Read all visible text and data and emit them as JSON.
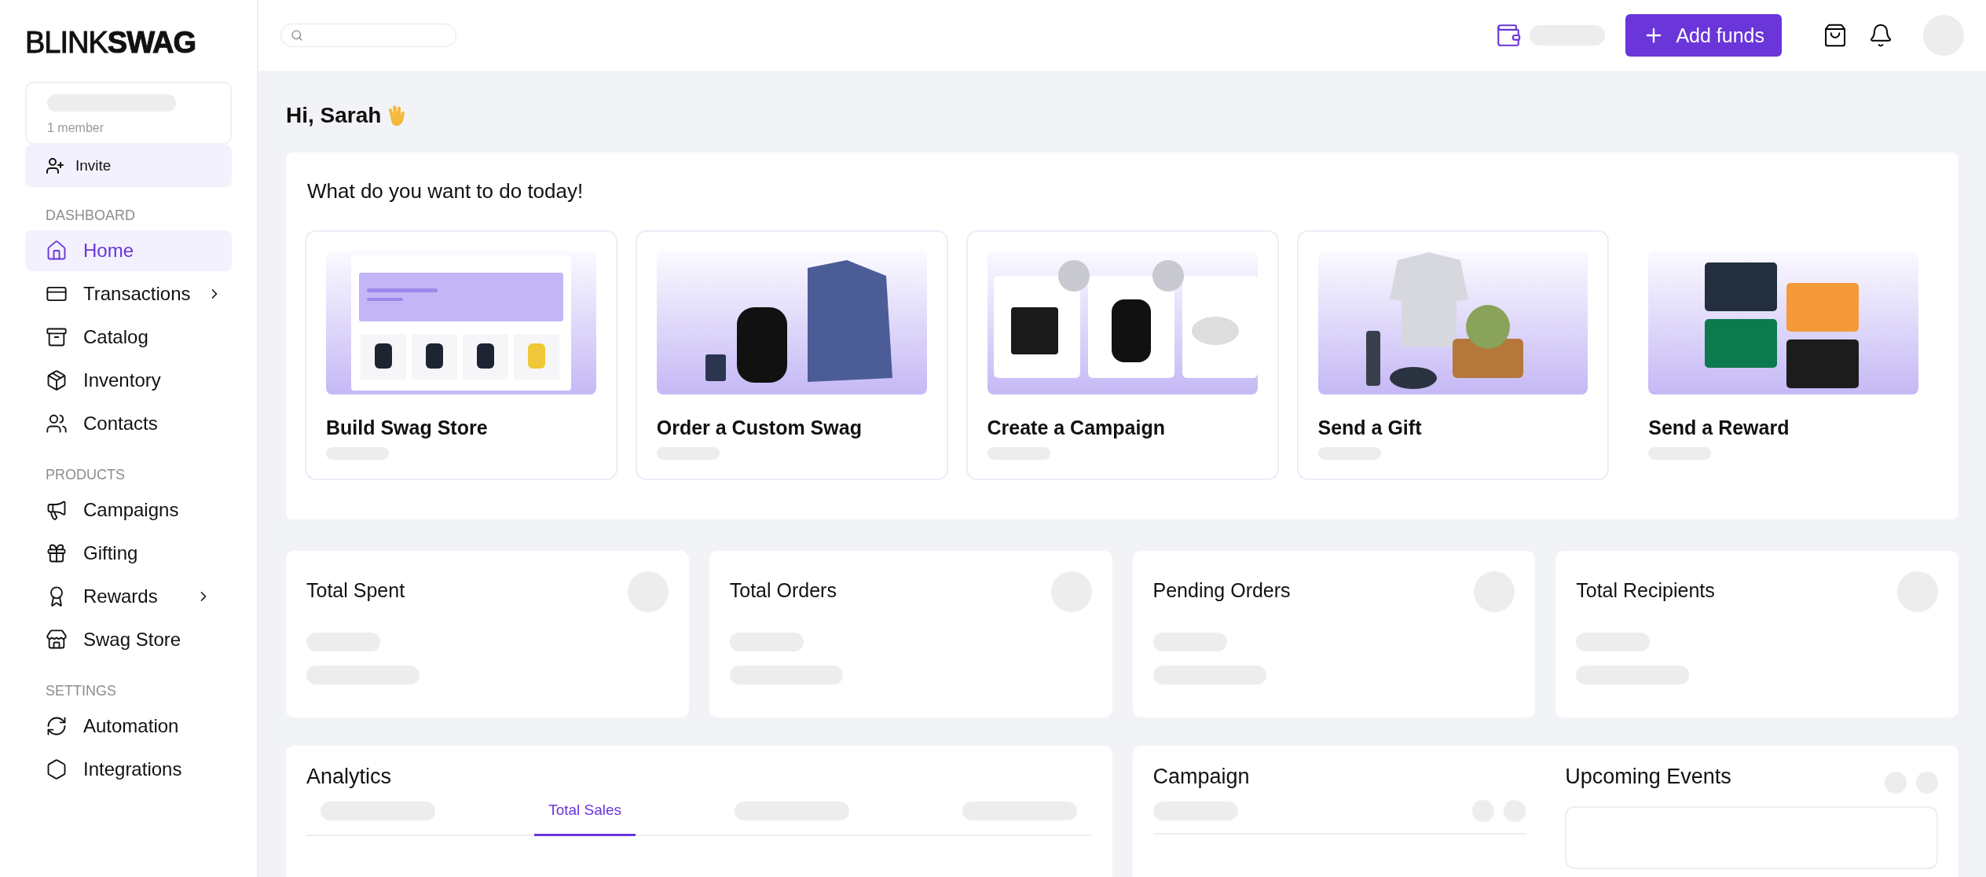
{
  "brand": {
    "logo_left": "BLINK",
    "logo_right": "SWAG"
  },
  "team": {
    "members": "1 member",
    "invite": "Invite"
  },
  "sidebar": {
    "sections": [
      {
        "heading": "DASHBOARD",
        "items": [
          {
            "label": "Home",
            "selected": true,
            "has_submenu": false
          },
          {
            "label": "Transactions",
            "selected": false,
            "has_submenu": true
          },
          {
            "label": "Catalog",
            "selected": false,
            "has_submenu": false
          },
          {
            "label": "Inventory",
            "selected": false,
            "has_submenu": false
          },
          {
            "label": "Contacts",
            "selected": false,
            "has_submenu": false
          }
        ]
      },
      {
        "heading": "PRODUCTS",
        "items": [
          {
            "label": "Campaigns",
            "selected": false,
            "has_submenu": false
          },
          {
            "label": "Gifting",
            "selected": false,
            "has_submenu": false
          },
          {
            "label": "Rewards",
            "selected": false,
            "has_submenu": true
          },
          {
            "label": "Swag Store",
            "selected": false,
            "has_submenu": false
          }
        ]
      },
      {
        "heading": "SETTINGS",
        "items": [
          {
            "label": "Automation",
            "selected": false,
            "has_submenu": false
          },
          {
            "label": "Integrations",
            "selected": false,
            "has_submenu": false
          }
        ]
      }
    ]
  },
  "topbar": {
    "add_funds": "Add funds"
  },
  "greeting": "Hi, Sarah",
  "actions": {
    "title": "What do you want to do today!",
    "cards": [
      {
        "kind": "store",
        "title": "Build Swag Store"
      },
      {
        "kind": "swag",
        "title": "Order a Custom Swag"
      },
      {
        "kind": "campaign",
        "title": "Create a Campaign"
      },
      {
        "kind": "gift",
        "title": "Send a Gift"
      },
      {
        "kind": "reward",
        "title": "Send a Reward"
      }
    ]
  },
  "stats": [
    {
      "title": "Total Spent"
    },
    {
      "title": "Total Orders"
    },
    {
      "title": "Pending Orders"
    },
    {
      "title": "Total Recipients"
    }
  ],
  "analytics": {
    "title": "Analytics",
    "tabs": [
      {
        "kind": "skeleton",
        "selected": false
      },
      {
        "kind": "text",
        "label": "Total Sales",
        "selected": true
      },
      {
        "kind": "skeleton",
        "selected": false
      },
      {
        "kind": "skeleton",
        "selected": false
      }
    ]
  },
  "campaign": {
    "title": "Campaign"
  },
  "upcoming_events": {
    "title": "Upcoming Events"
  }
}
